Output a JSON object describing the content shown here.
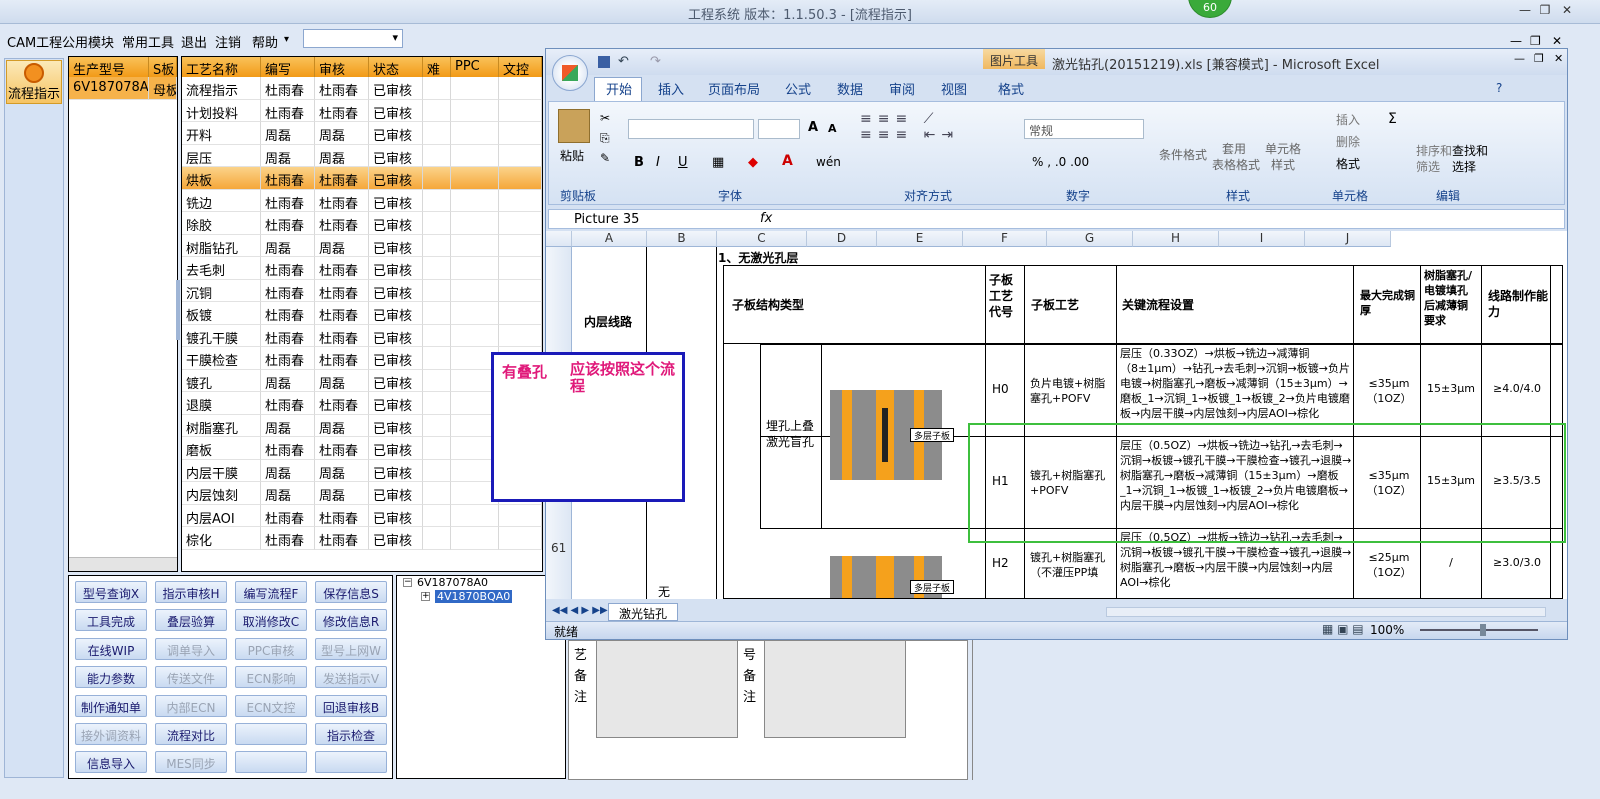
{
  "app": {
    "title": "工程系统  版本：1.1.50.3 - [流程指示]",
    "badge": "60",
    "menu": [
      "CAM工程",
      "公用模块",
      "常用工具",
      "退出",
      "注销",
      "帮助"
    ],
    "help_arrow": "▾",
    "win_min": "—",
    "win_max": "❐",
    "win_close": "✕"
  },
  "nav": {
    "button_label": "流程指示"
  },
  "left_grid": {
    "headers": [
      "生产型号",
      "S板"
    ],
    "rows": [
      [
        "6V187078A0",
        "母板"
      ]
    ]
  },
  "process_grid": {
    "headers": [
      "工艺名称",
      "编写",
      "审核",
      "状态",
      "难",
      "PPC",
      "文控"
    ],
    "rows": [
      [
        "流程指示",
        "杜雨春",
        "杜雨春",
        "已审核"
      ],
      [
        "计划投料",
        "杜雨春",
        "杜雨春",
        "已审核"
      ],
      [
        "开料",
        "周磊",
        "周磊",
        "已审核"
      ],
      [
        "层压",
        "周磊",
        "周磊",
        "已审核"
      ],
      [
        "烘板",
        "杜雨春",
        "杜雨春",
        "已审核"
      ],
      [
        "铣边",
        "杜雨春",
        "杜雨春",
        "已审核"
      ],
      [
        "除胶",
        "杜雨春",
        "杜雨春",
        "已审核"
      ],
      [
        "树脂钻孔",
        "周磊",
        "周磊",
        "已审核"
      ],
      [
        "去毛刺",
        "杜雨春",
        "杜雨春",
        "已审核"
      ],
      [
        "沉铜",
        "杜雨春",
        "杜雨春",
        "已审核"
      ],
      [
        "板镀",
        "杜雨春",
        "杜雨春",
        "已审核"
      ],
      [
        "镀孔干膜",
        "杜雨春",
        "杜雨春",
        "已审核"
      ],
      [
        "干膜检查",
        "杜雨春",
        "杜雨春",
        "已审核"
      ],
      [
        "镀孔",
        "周磊",
        "周磊",
        "已审核"
      ],
      [
        "退膜",
        "杜雨春",
        "杜雨春",
        "已审核"
      ],
      [
        "树脂塞孔",
        "周磊",
        "周磊",
        "已审核"
      ],
      [
        "磨板",
        "杜雨春",
        "杜雨春",
        "已审核"
      ],
      [
        "内层干膜",
        "周磊",
        "周磊",
        "已审核"
      ],
      [
        "内层蚀刻",
        "周磊",
        "周磊",
        "已审核"
      ],
      [
        "内层AOI",
        "杜雨春",
        "杜雨春",
        "已审核"
      ],
      [
        "棕化",
        "杜雨春",
        "杜雨春",
        "已审核"
      ]
    ],
    "selected_index": 4
  },
  "buttons": [
    [
      "型号查询X",
      "指示审核H",
      "编写流程F",
      "保存信息S"
    ],
    [
      "工具完成",
      "叠层验算",
      "取消修改C",
      "修改信息R"
    ],
    [
      "在线WIP",
      "调单导入",
      "PPC审核",
      "型号上网W"
    ],
    [
      "能力参数",
      "传送文件",
      "ECN影响",
      "发送指示V"
    ],
    [
      "制作通知单",
      "内部ECN",
      "ECN文控",
      "回退审核B"
    ],
    [
      "接外调资料",
      "流程对比",
      "",
      "指示检查"
    ],
    [
      "信息导入",
      "MES同步",
      "",
      ""
    ]
  ],
  "buttons_disabled": [
    [
      false,
      false,
      false,
      false
    ],
    [
      false,
      false,
      false,
      false
    ],
    [
      false,
      true,
      true,
      true
    ],
    [
      false,
      true,
      true,
      true
    ],
    [
      false,
      true,
      true,
      false
    ],
    [
      true,
      false,
      false,
      false
    ],
    [
      false,
      true,
      false,
      false
    ]
  ],
  "tree": {
    "root": "6V187078A0",
    "child": "4V1870BQA0",
    "toggle_root": "−",
    "toggle_child": "+"
  },
  "excel": {
    "tool_tab": "图片工具",
    "title": "激光钻孔(20151219).xls  [兼容模式] - Microsoft Excel",
    "tabs": [
      "开始",
      "插入",
      "页面布局",
      "公式",
      "数据",
      "审阅",
      "视图",
      "格式"
    ],
    "groups": [
      "剪贴板",
      "字体",
      "对齐方式",
      "数字",
      "样式",
      "单元格",
      "编辑"
    ],
    "clipboard_paste": "粘贴",
    "number_format": "常规",
    "styles": [
      "条件格式",
      "套用\n表格格式",
      "单元格\n样式"
    ],
    "cells_ops": [
      "插入",
      "删除",
      "格式"
    ],
    "edit_ops": [
      "排序和\n筛选",
      "查找和\n选择"
    ],
    "name_box": "Picture 35",
    "fx": "fx",
    "columns": [
      "A",
      "B",
      "C",
      "D",
      "E",
      "F",
      "G",
      "H",
      "I",
      "J"
    ],
    "row_number": "61",
    "section_title": "1、无激光孔层",
    "left_label": "内层线路",
    "left_label2": "无",
    "table_headers": [
      "子板结构类型",
      "子板工艺代号",
      "子板工艺",
      "关键流程设置",
      "最大完成铜厚",
      "树脂塞孔/电镀填孔后减薄铜要求",
      "线路制作能力"
    ],
    "structure_label": "埋孔上叠激光盲孔",
    "img_label": "多层子板",
    "rows": [
      {
        "code": "H0",
        "process": "负片电镀+树脂塞孔+POFV",
        "flow": "层压（0.33OZ）→烘板→铣边→减薄铜（8±1μm）→钻孔→去毛刺→沉铜→板镀→负片电镀→树脂塞孔→磨板→减薄铜（15±3μm）→磨板_1→沉铜_1→板镀_1→板镀_2→负片电镀磨板→内层干膜→内层蚀刻→内层AOI→棕化",
        "copper": "≤35μm（1OZ）",
        "thin": "15±3μm",
        "ability": "≥4.0/4.0"
      },
      {
        "code": "H1",
        "process": "镀孔+树脂塞孔+POFV",
        "flow": "层压（0.5OZ）→烘板→铣边→钻孔→去毛刺→沉铜→板镀→镀孔干膜→干膜检查→镀孔→退膜→树脂塞孔→磨板→减薄铜（15±3μm）→磨板_1→沉铜_1→板镀_1→板镀_2→负片电镀磨板→内层干膜→内层蚀刻→内层AOI→棕化",
        "copper": "≤35μm（1OZ）",
        "thin": "15±3μm",
        "ability": "≥3.5/3.5"
      },
      {
        "code": "H2",
        "process": "镀孔+树脂塞孔（不灌压PP填",
        "flow": "层压（0.5OZ）→烘板→铣边→钻孔→去毛刺→沉铜→板镀→镀孔干膜→干膜检查→镀孔→退膜→树脂塞孔→磨板→内层干膜→内层蚀刻→内层AOI→棕化",
        "copper": "≤25μm（1OZ）",
        "thin": "/",
        "ability": "≥3.0/3.0"
      }
    ],
    "sheet_tab": "激光钻孔",
    "status": "就绪",
    "zoom": "100%"
  },
  "note": {
    "text1": "有叠孔",
    "text2": "应该按照这个流程"
  },
  "memo": {
    "left_label": "艺\n备\n注",
    "right_label": "号\n备\n注"
  },
  "colors": {
    "accent": "#f29a17",
    "note_border": "#1a1ab8",
    "note_text": "#e0197a",
    "green": "#3dbf3d"
  }
}
